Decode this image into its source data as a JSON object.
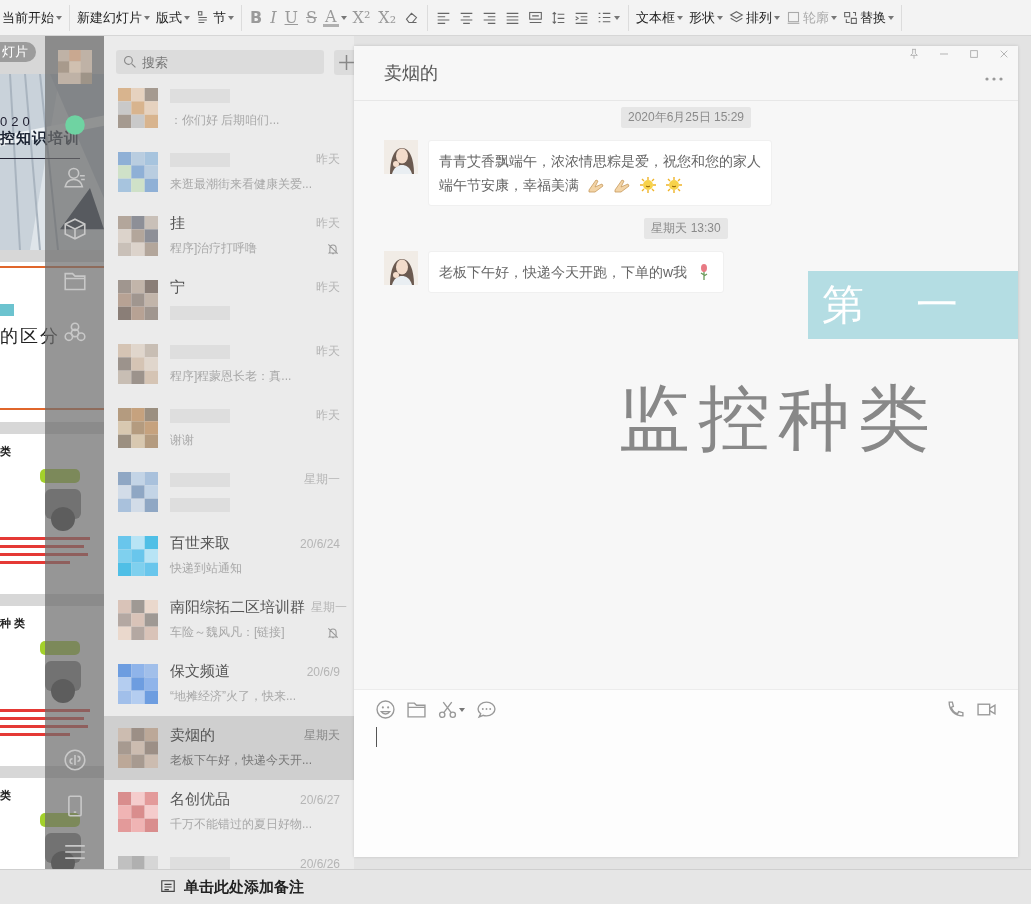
{
  "ribbon": {
    "groups": [
      [
        {
          "kind": "text",
          "label": "当前开始",
          "dropdown": true,
          "disabled": false
        }
      ],
      [
        {
          "kind": "text",
          "label": "新建幻灯片",
          "dropdown": true,
          "disabled": false
        },
        {
          "kind": "text",
          "label": "版式",
          "dropdown": true,
          "disabled": false
        },
        {
          "kind": "text",
          "label": "节",
          "dropdown": true,
          "disabled": false
        }
      ],
      [
        {
          "kind": "glyph",
          "label": "B",
          "dropdown": false,
          "disabled": false
        },
        {
          "kind": "glyph",
          "label": "I",
          "dropdown": false,
          "disabled": false
        },
        {
          "kind": "glyph",
          "label": "U",
          "dropdown": false,
          "disabled": false
        },
        {
          "kind": "glyph",
          "label": "S",
          "dropdown": false,
          "disabled": false
        },
        {
          "kind": "glyph",
          "label": "A",
          "dropdown": true,
          "disabled": false
        },
        {
          "kind": "glyph",
          "label": "X²",
          "dropdown": false,
          "disabled": false
        },
        {
          "kind": "glyph",
          "label": "X₂",
          "dropdown": false,
          "disabled": false
        },
        {
          "kind": "icon",
          "dropdown": false,
          "disabled": false
        }
      ],
      [
        {
          "kind": "icon",
          "dropdown": false,
          "disabled": false
        },
        {
          "kind": "icon",
          "dropdown": false,
          "disabled": false
        },
        {
          "kind": "icon",
          "dropdown": false,
          "disabled": false
        },
        {
          "kind": "icon",
          "dropdown": false,
          "disabled": false
        },
        {
          "kind": "icon",
          "dropdown": false,
          "disabled": false
        },
        {
          "kind": "icon",
          "dropdown": false,
          "disabled": false
        },
        {
          "kind": "icon",
          "dropdown": false,
          "disabled": false
        },
        {
          "kind": "icon",
          "dropdown": true,
          "disabled": false
        }
      ],
      [
        {
          "kind": "text",
          "label": "文本框",
          "dropdown": true,
          "disabled": false
        },
        {
          "kind": "text",
          "label": "形状",
          "dropdown": true,
          "disabled": false
        },
        {
          "kind": "text",
          "label": "排列",
          "dropdown": true,
          "disabled": false
        },
        {
          "kind": "text",
          "label": "轮廓",
          "dropdown": true,
          "disabled": true
        },
        {
          "kind": "text",
          "label": "替换",
          "dropdown": true,
          "disabled": false
        }
      ]
    ]
  },
  "slide_pane": {
    "button": "灯片",
    "slides": [
      {
        "kind": "cover",
        "texts": [
          "020",
          "控知识培训"
        ]
      },
      {
        "kind": "chapter",
        "texts": [
          "的区分"
        ]
      },
      {
        "kind": "content",
        "texts": [
          "类"
        ]
      },
      {
        "kind": "content",
        "texts": [
          "种 类"
        ]
      },
      {
        "kind": "content",
        "texts": [
          "类"
        ]
      }
    ]
  },
  "nav": {
    "items": [
      {
        "selected": true
      },
      {
        "selected": false
      },
      {
        "selected": false
      },
      {
        "selected": false
      },
      {
        "selected": false
      }
    ]
  },
  "chat_list": {
    "search_placeholder": "搜索",
    "chats": [
      {
        "preview": "：你们好  后期咱们...",
        "muted": false,
        "selected": false
      },
      {
        "time": "昨天",
        "preview": "来逛最潮街来看健康关爱...",
        "muted": false,
        "selected": false
      },
      {
        "name": "挂",
        "time": "昨天",
        "preview": "程序]治疗打呼噜",
        "muted": true,
        "selected": false
      },
      {
        "name": "宁",
        "time": "昨天",
        "muted": false,
        "selected": false
      },
      {
        "time": "昨天",
        "preview": "程序]程蒙恩长老：真...",
        "muted": false,
        "selected": false
      },
      {
        "time": "昨天",
        "preview": "谢谢",
        "muted": false,
        "selected": false
      },
      {
        "time": "星期一",
        "muted": false,
        "selected": false
      },
      {
        "name": "百世来取",
        "time": "20/6/24",
        "preview": "快递到站通知",
        "muted": false,
        "selected": false
      },
      {
        "name": "南阳综拓二区培训群",
        "time": "星期一",
        "preview": "车险～魏风凡：[链接]",
        "muted": true,
        "selected": false
      },
      {
        "name": "保文频道",
        "time": "20/6/9",
        "preview": "“地摊经济”火了，快来...",
        "muted": false,
        "selected": false
      },
      {
        "name": "卖烟的",
        "time": "星期天",
        "preview": "老板下午好，快递今天开...",
        "muted": false,
        "selected": true
      },
      {
        "name": "名创优品",
        "time": "20/6/27",
        "preview": "千万不能错过的夏日好物...",
        "muted": false,
        "selected": false
      },
      {
        "time": "20/6/26",
        "muted": false,
        "selected": false
      }
    ]
  },
  "chat": {
    "title": "卖烟的",
    "messages": [
      {
        "kind": "time",
        "text": "2020年6月25日 15:29"
      },
      {
        "kind": "message",
        "lines": [
          "青青艾香飘端午，浓浓情思粽是爱，祝您和您的家人",
          "端午节安康，幸福美满"
        ]
      },
      {
        "kind": "time",
        "text": "星期天 13:30"
      },
      {
        "kind": "message",
        "lines": [
          "老板下午好，快递今天开跑，下单的w我"
        ]
      }
    ],
    "slide_overlay": {
      "chapter": "第 一",
      "title": "监控种类"
    }
  },
  "notes": {
    "placeholder": "单击此处添加备注"
  }
}
